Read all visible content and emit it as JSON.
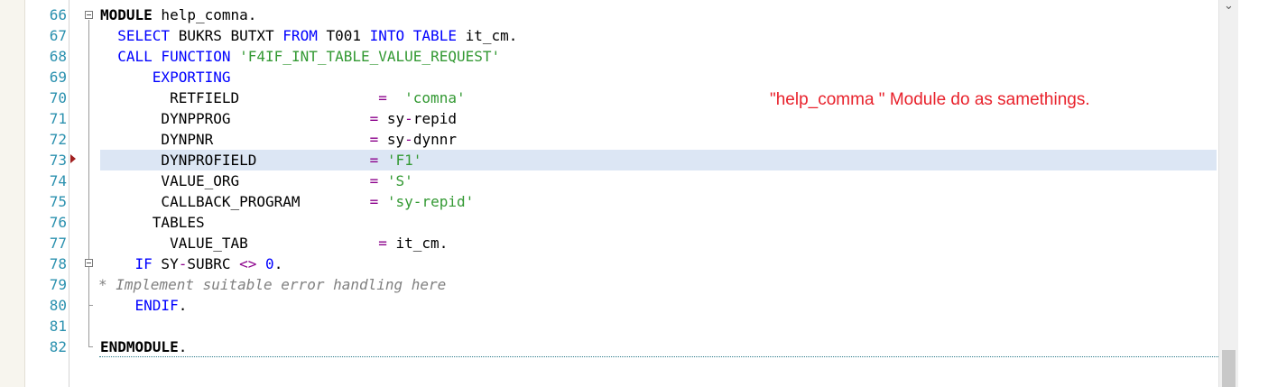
{
  "editor": {
    "lines": [
      {
        "n": "66",
        "parts": [
          {
            "t": "MODULE",
            "c": "kwb"
          },
          {
            "t": " help_comna."
          }
        ]
      },
      {
        "n": "67",
        "parts": [
          {
            "t": "  "
          },
          {
            "t": "SELECT",
            "c": "kw"
          },
          {
            "t": " BUKRS BUTXT "
          },
          {
            "t": "FROM",
            "c": "kw"
          },
          {
            "t": " T001 "
          },
          {
            "t": "INTO TABLE",
            "c": "kw"
          },
          {
            "t": " it_cm."
          }
        ]
      },
      {
        "n": "68",
        "parts": [
          {
            "t": "  "
          },
          {
            "t": "CALL FUNCTION",
            "c": "kw"
          },
          {
            "t": " "
          },
          {
            "t": "'F4IF_INT_TABLE_VALUE_REQUEST'",
            "c": "str"
          }
        ]
      },
      {
        "n": "69",
        "parts": [
          {
            "t": "      "
          },
          {
            "t": "EXPORTING",
            "c": "kw"
          }
        ]
      },
      {
        "n": "70",
        "parts": [
          {
            "t": "        RETFIELD                "
          },
          {
            "t": "=",
            "c": "op"
          },
          {
            "t": "  "
          },
          {
            "t": "'comna'",
            "c": "str"
          }
        ]
      },
      {
        "n": "71",
        "parts": [
          {
            "t": "       DYNPPROG                "
          },
          {
            "t": "=",
            "c": "op"
          },
          {
            "t": " sy"
          },
          {
            "t": "-",
            "c": "op"
          },
          {
            "t": "repid"
          }
        ]
      },
      {
        "n": "72",
        "parts": [
          {
            "t": "       DYNPNR                  "
          },
          {
            "t": "=",
            "c": "op"
          },
          {
            "t": " sy"
          },
          {
            "t": "-",
            "c": "op"
          },
          {
            "t": "dynnr"
          }
        ]
      },
      {
        "n": "73",
        "parts": [
          {
            "t": "       DYNPROFIELD             "
          },
          {
            "t": "=",
            "c": "op"
          },
          {
            "t": " "
          },
          {
            "t": "'F1'",
            "c": "str"
          }
        ]
      },
      {
        "n": "74",
        "parts": [
          {
            "t": "       VALUE_ORG               "
          },
          {
            "t": "=",
            "c": "op"
          },
          {
            "t": " "
          },
          {
            "t": "'S'",
            "c": "str"
          }
        ]
      },
      {
        "n": "75",
        "parts": [
          {
            "t": "       CALLBACK_PROGRAM        "
          },
          {
            "t": "=",
            "c": "op"
          },
          {
            "t": " "
          },
          {
            "t": "'sy-repid'",
            "c": "str"
          }
        ]
      },
      {
        "n": "76",
        "parts": [
          {
            "t": "      TABLES"
          }
        ]
      },
      {
        "n": "77",
        "parts": [
          {
            "t": "        VALUE_TAB               "
          },
          {
            "t": "=",
            "c": "op"
          },
          {
            "t": " it_cm."
          }
        ]
      },
      {
        "n": "78",
        "parts": [
          {
            "t": "    "
          },
          {
            "t": "IF",
            "c": "kw"
          },
          {
            "t": " SY"
          },
          {
            "t": "-",
            "c": "op"
          },
          {
            "t": "SUBRC "
          },
          {
            "t": "<>",
            "c": "op"
          },
          {
            "t": " "
          },
          {
            "t": "0",
            "c": "kw"
          },
          {
            "t": "."
          }
        ]
      },
      {
        "n": "79",
        "parts": [
          {
            "t": "* Implement suitable error handling here",
            "c": "cmt"
          }
        ]
      },
      {
        "n": "80",
        "parts": [
          {
            "t": "    "
          },
          {
            "t": "ENDIF",
            "c": "kw"
          },
          {
            "t": "."
          }
        ]
      },
      {
        "n": "81",
        "parts": [
          {
            "t": ""
          }
        ]
      },
      {
        "n": "82",
        "parts": [
          {
            "t": "ENDMODULE",
            "c": "kwb"
          },
          {
            "t": "."
          }
        ]
      }
    ],
    "highlighted_line": "73",
    "annotation": "\"help_comma \" Module do as samethings.",
    "scroll_up_icon": "chevron-down-icon",
    "colors": {
      "keyword": "#0000ff",
      "string": "#339933",
      "operator": "#8b008b",
      "comment": "#808080",
      "line_number": "#2b91af",
      "highlight": "#dce6f4",
      "annotation": "#e8212b"
    }
  }
}
